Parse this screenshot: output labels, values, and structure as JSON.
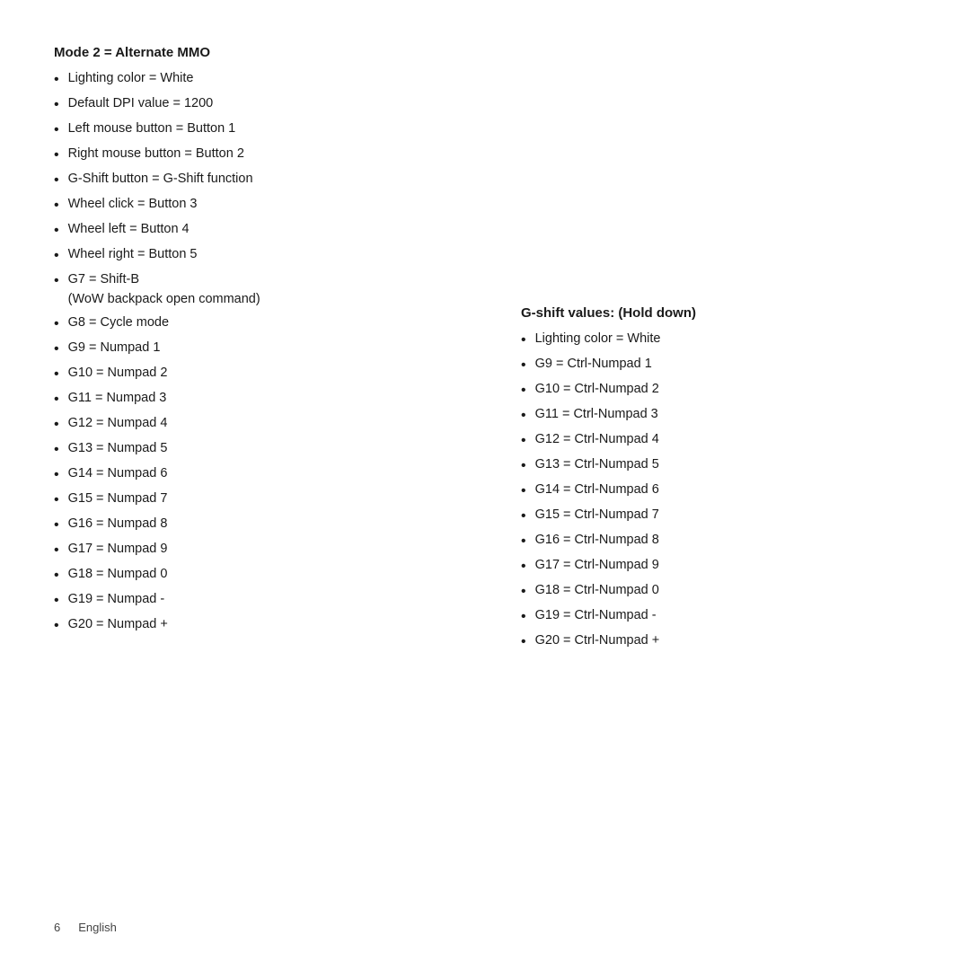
{
  "page": {
    "footer": {
      "page_number": "6",
      "language": "English"
    }
  },
  "left_section": {
    "title": "Mode 2 = Alternate MMO",
    "items": [
      {
        "text": "Lighting color = White",
        "sub": null
      },
      {
        "text": "Default DPI value = 1200",
        "sub": null
      },
      {
        "text": "Left mouse button = Button 1",
        "sub": null
      },
      {
        "text": "Right mouse button = Button 2",
        "sub": null
      },
      {
        "text": "G-Shift button = G-Shift function",
        "sub": null
      },
      {
        "text": "Wheel click = Button 3",
        "sub": null
      },
      {
        "text": "Wheel left = Button 4",
        "sub": null
      },
      {
        "text": "Wheel right = Button 5",
        "sub": null
      },
      {
        "text": "G7  =  Shift-B",
        "sub": "(WoW backpack open command)"
      },
      {
        "text": "G8  =  Cycle mode",
        "sub": null
      },
      {
        "text": "G9  =  Numpad 1",
        "sub": null
      },
      {
        "text": "G10 =  Numpad 2",
        "sub": null
      },
      {
        "text": "G11 =  Numpad 3",
        "sub": null
      },
      {
        "text": "G12 =  Numpad 4",
        "sub": null
      },
      {
        "text": "G13 =  Numpad 5",
        "sub": null
      },
      {
        "text": "G14 =  Numpad 6",
        "sub": null
      },
      {
        "text": "G15 =  Numpad 7",
        "sub": null
      },
      {
        "text": "G16 =  Numpad 8",
        "sub": null
      },
      {
        "text": "G17 =  Numpad 9",
        "sub": null
      },
      {
        "text": "G18 =  Numpad 0",
        "sub": null
      },
      {
        "text": "G19 =  Numpad -",
        "sub": null
      },
      {
        "text": "G20 =  Numpad +",
        "sub": null
      }
    ]
  },
  "right_section": {
    "title": "G-shift values: (Hold down)",
    "items": [
      {
        "text": "Lighting color = White"
      },
      {
        "text": "G9  =  Ctrl-Numpad 1"
      },
      {
        "text": "G10 =  Ctrl-Numpad 2"
      },
      {
        "text": "G11 =  Ctrl-Numpad 3"
      },
      {
        "text": "G12 =  Ctrl-Numpad 4"
      },
      {
        "text": "G13 =  Ctrl-Numpad 5"
      },
      {
        "text": "G14 =  Ctrl-Numpad 6"
      },
      {
        "text": "G15 =  Ctrl-Numpad 7"
      },
      {
        "text": "G16 =  Ctrl-Numpad 8"
      },
      {
        "text": "G17 =  Ctrl-Numpad 9"
      },
      {
        "text": "G18 =  Ctrl-Numpad 0"
      },
      {
        "text": "G19 =  Ctrl-Numpad -"
      },
      {
        "text": "G20 =  Ctrl-Numpad +"
      }
    ]
  }
}
